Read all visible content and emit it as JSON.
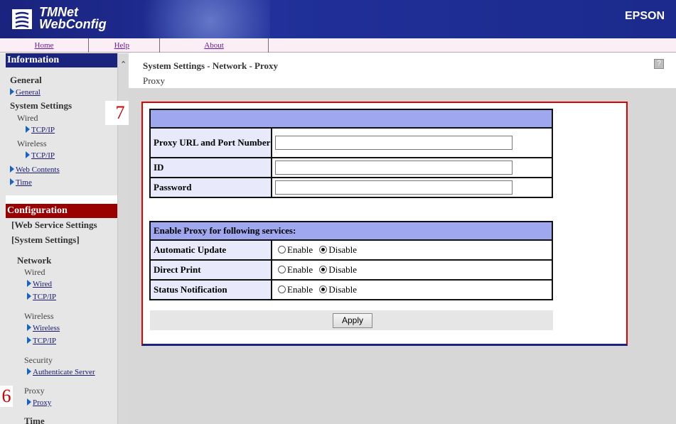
{
  "header": {
    "logo_line1": "TMNet",
    "logo_line2": "WebConfig",
    "brand": "EPSON"
  },
  "menu": {
    "home": "Home",
    "help": "Help",
    "about": "About"
  },
  "sidebar": {
    "information": {
      "title": "Information",
      "general_heading": "General",
      "general_link": "General",
      "system_settings_heading": "System Settings",
      "wired_label": "Wired",
      "wired_tcpip": "TCP/IP",
      "wireless_label": "Wireless",
      "wireless_tcpip": "TCP/IP",
      "web_contents": "Web Contents",
      "time": "Time"
    },
    "configuration": {
      "title": "Configuration",
      "web_service_settings": "[Web Service Settings",
      "system_settings": "[System Settings]",
      "network_heading": "Network",
      "wired_label": "Wired",
      "wired_link": "Wired",
      "wired_tcpip": "TCP/IP",
      "wireless_label": "Wireless",
      "wireless_link": "Wireless",
      "wireless_tcpip": "TCP/IP",
      "security_label": "Security",
      "authenticate_server": "Authenticate Server",
      "proxy_label": "Proxy",
      "proxy_link": "Proxy",
      "time_heading": "Time"
    }
  },
  "callouts": {
    "six": "6",
    "seven": "7"
  },
  "main": {
    "title": "System Settings - Network - Proxy",
    "subtitle": "Proxy",
    "help_icon": "?",
    "fields": {
      "proxy_url_label": "Proxy URL and Port Number",
      "proxy_url_value": "",
      "id_label": "ID",
      "id_value": "",
      "password_label": "Password",
      "password_value": ""
    },
    "services": {
      "heading": "Enable Proxy for following services:",
      "enable_label": "Enable",
      "disable_label": "Disable",
      "rows": [
        {
          "label": "Automatic Update",
          "selected": "Disable"
        },
        {
          "label": "Direct Print",
          "selected": "Disable"
        },
        {
          "label": "Status Notification",
          "selected": "Disable"
        }
      ]
    },
    "apply_label": "Apply"
  },
  "colors": {
    "header_blue": "#1a237e",
    "config_red": "#9b0000",
    "table_header": "#9fa8ef",
    "callout_red": "#d00000"
  }
}
